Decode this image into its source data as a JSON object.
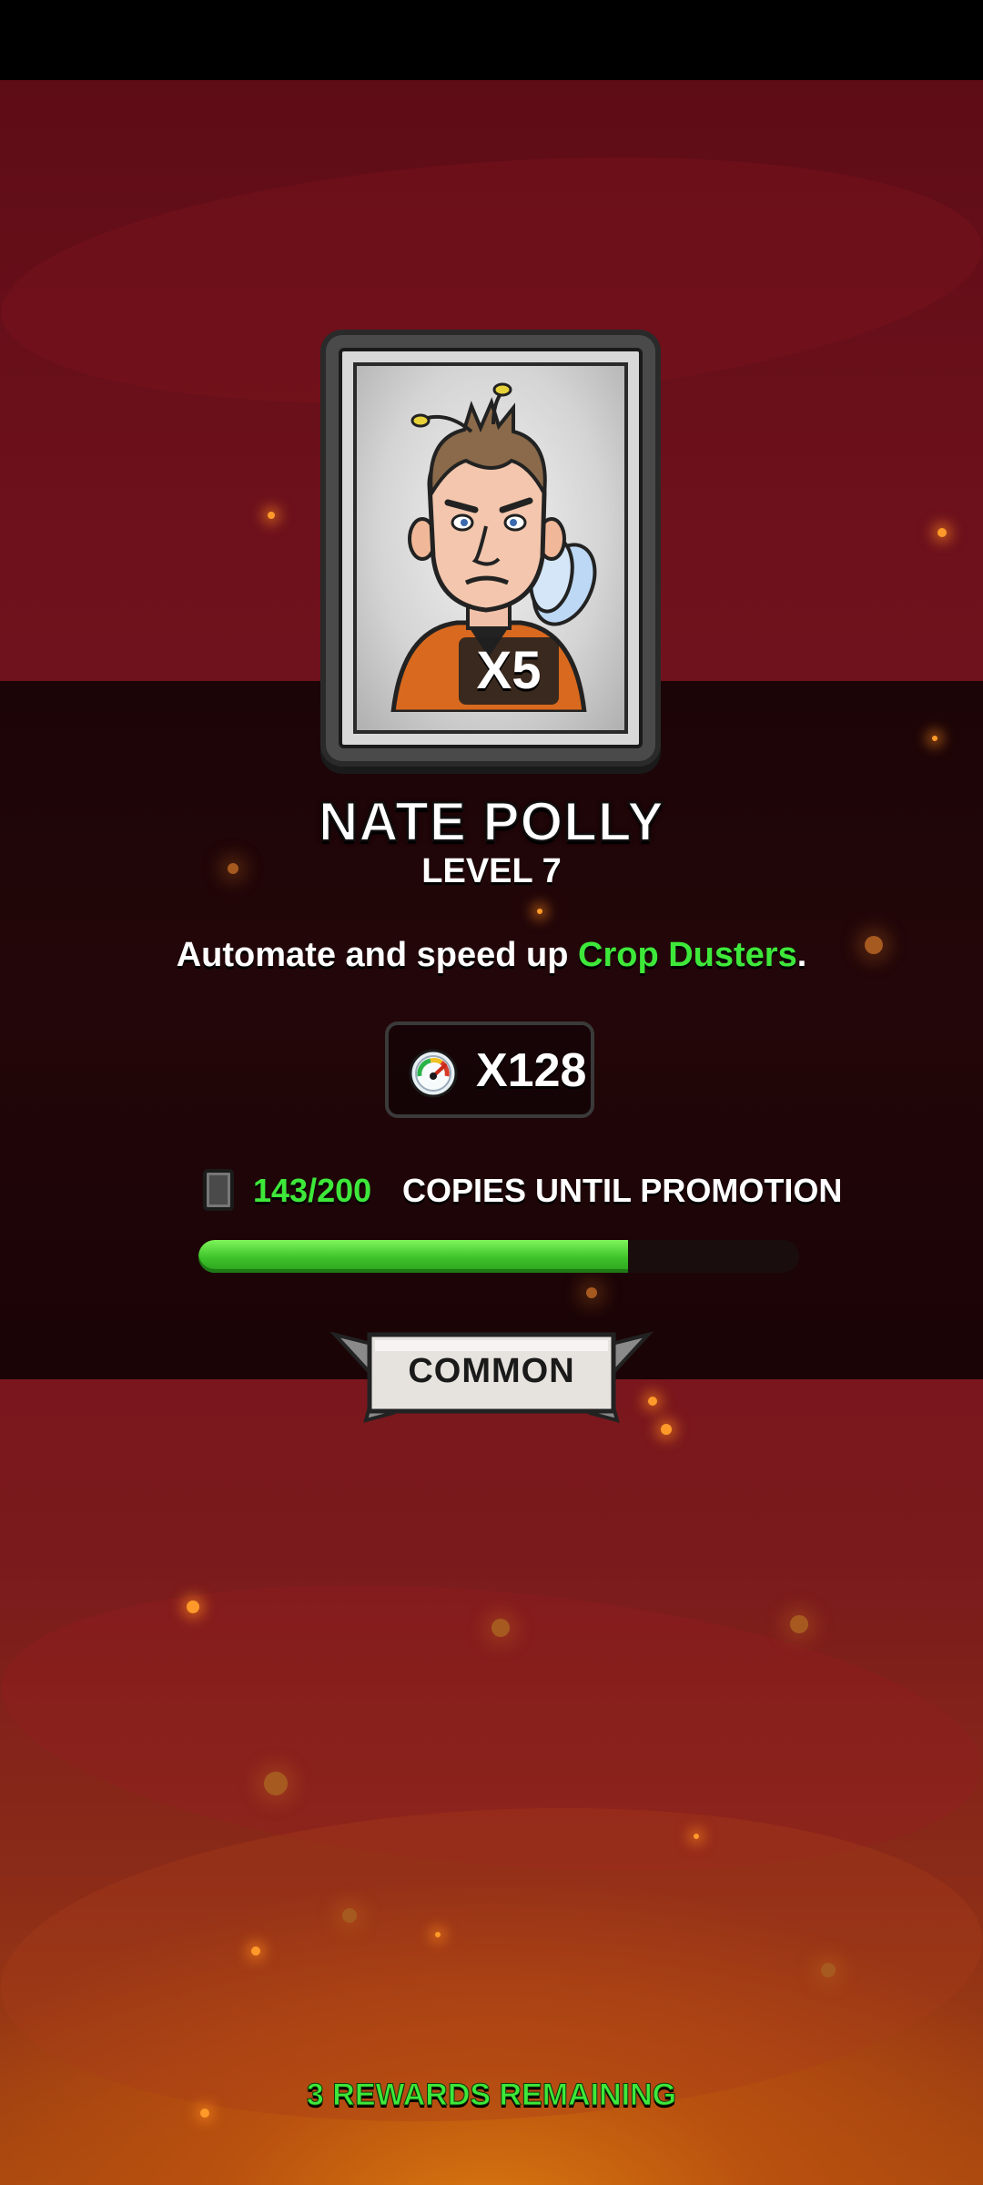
{
  "card": {
    "multiplier": "X5",
    "portrait_icon": "bee-character-portrait"
  },
  "character": {
    "name": "NATE POLLY",
    "level": "LEVEL 7"
  },
  "description": {
    "prefix": "Automate and speed up ",
    "highlight": "Crop Dusters",
    "suffix": "."
  },
  "speed": {
    "icon": "speedometer-icon",
    "value": "X128"
  },
  "promotion": {
    "count": "143/200",
    "label": "COPIES UNTIL PROMOTION",
    "current": 143,
    "total": 200
  },
  "rarity": {
    "label": "COMMON"
  },
  "footer": {
    "rewards_remaining": "3 REWARDS REMAINING"
  },
  "colors": {
    "accent_green": "#3ee83a",
    "background_red": "#6d111c",
    "band_dark": "#1c0507"
  }
}
